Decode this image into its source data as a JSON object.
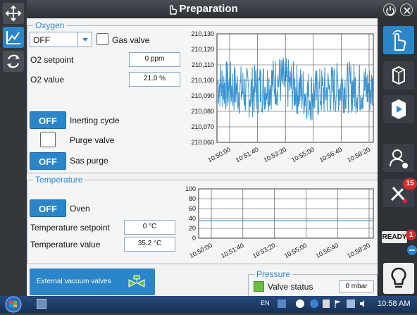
{
  "window": {
    "title": "Preparation"
  },
  "oxygen": {
    "legend": "Oxygen",
    "mode_select": "OFF",
    "gas_valve_label": "Gas valve",
    "o2_setpoint_label": "O2 setpoint",
    "o2_setpoint_value": "0 ppm",
    "o2_value_label": "O2 value",
    "o2_value": "21.0 %",
    "inerting_btn": "OFF",
    "inerting_label": "Inerting cycle",
    "purge_valve_label": "Purge valve",
    "sas_purge_btn": "OFF",
    "sas_purge_label": "Sas purge",
    "chart": {
      "y_ticks": [
        "210,130",
        "210,120",
        "210,110",
        "210,100",
        "210,090",
        "210,080",
        "210,070",
        "210.060"
      ],
      "x_ticks": [
        "10:50:00",
        "10:51:40",
        "10:53:20",
        "10:55:00",
        "10:56:40",
        "10:58:20"
      ]
    }
  },
  "temperature": {
    "legend": "Temperature",
    "oven_btn": "OFF",
    "oven_label": "Oven",
    "setpoint_label": "Temperature setpoint",
    "setpoint_value": "0 °C",
    "value_label": "Temperature value",
    "value": "35.2 °C",
    "chart": {
      "y_ticks": [
        "100",
        "80",
        "60",
        "40",
        "20",
        "0"
      ],
      "x_ticks": [
        "10:50:00",
        "10:51:40",
        "10:53:20",
        "10:55:00",
        "10:56:40",
        "10:58:20"
      ]
    }
  },
  "vacuum_btn": "External vacuum valves",
  "pressure": {
    "legend": "Pressure",
    "valve_status_label": "Valve status",
    "value": "0 mbar"
  },
  "sidebar_right": {
    "tools_badge": "15",
    "ready_label": "READY",
    "ready_badge": "1"
  },
  "taskbar": {
    "lang": "EN",
    "clock": "10:58 AM"
  },
  "colors": {
    "accent": "#2a86c9",
    "status_ok": "#6abf40"
  },
  "chart_data": [
    {
      "type": "line",
      "ylabel": "",
      "xlabel": "",
      "ylim": [
        210060,
        210130
      ],
      "x": [
        "10:50:00",
        "10:51:40",
        "10:53:20",
        "10:55:00",
        "10:56:40",
        "10:58:20"
      ],
      "series": [
        {
          "values": [
            210098,
            210092,
            210100,
            210090,
            210096,
            210094
          ]
        }
      ]
    },
    {
      "type": "line",
      "ylim": [
        0,
        100
      ],
      "x": [
        "10:50:00",
        "10:51:40",
        "10:53:20",
        "10:55:00",
        "10:56:40",
        "10:58:20"
      ],
      "series": [
        {
          "values": [
            35.2,
            35.2,
            35.2,
            35.2,
            35.2,
            35.2
          ]
        }
      ]
    }
  ]
}
